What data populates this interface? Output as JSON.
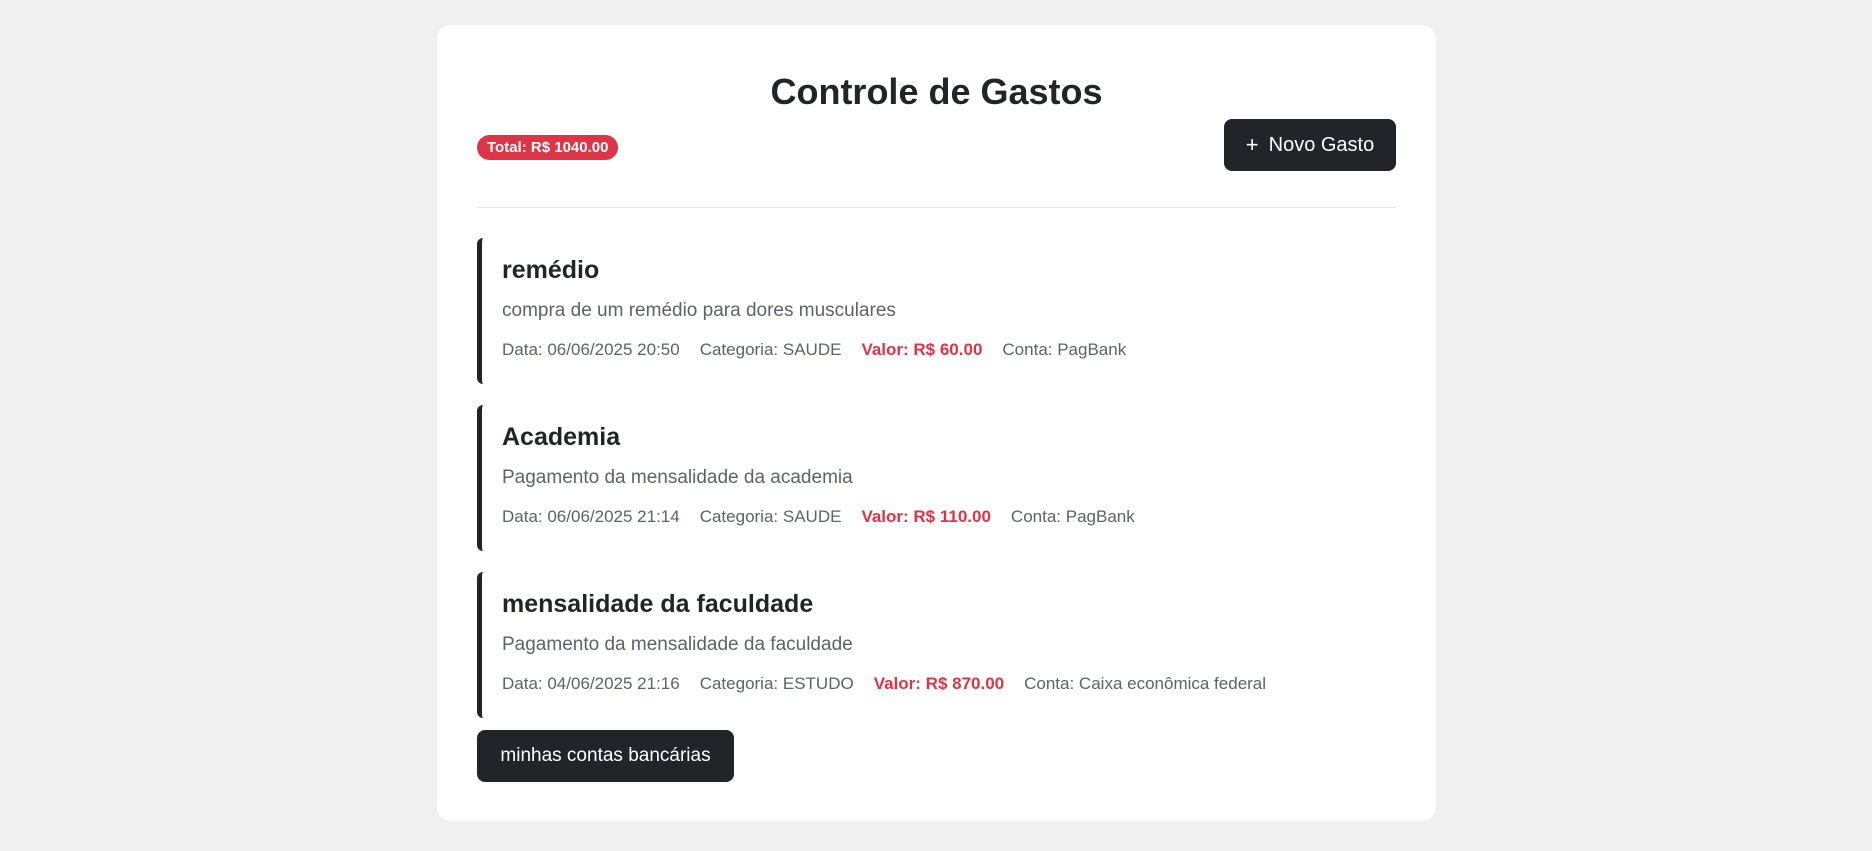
{
  "page": {
    "title": "Controle de Gastos"
  },
  "toolbar": {
    "total_label": "Total: R$ 1040.00",
    "new_button_icon": "+",
    "new_button_label": "Novo Gasto"
  },
  "expenses": [
    {
      "title": "remédio",
      "description": "compra de um remédio para dores musculares",
      "date": "Data: 06/06/2025 20:50",
      "category": "Categoria: SAUDE",
      "value": "Valor: R$ 60.00",
      "account": "Conta: PagBank"
    },
    {
      "title": "Academia",
      "description": "Pagamento da mensalidade da academia",
      "date": "Data: 06/06/2025 21:14",
      "category": "Categoria: SAUDE",
      "value": "Valor: R$ 110.00",
      "account": "Conta: PagBank"
    },
    {
      "title": "mensalidade da faculdade",
      "description": "Pagamento da mensalidade da faculdade",
      "date": "Data: 04/06/2025 21:16",
      "category": "Categoria: ESTUDO",
      "value": "Valor: R$ 870.00",
      "account": "Conta: Caixa econômica federal"
    }
  ],
  "footer": {
    "accounts_button_label": "minhas contas bancárias"
  },
  "colors": {
    "background": "#eff0ef",
    "card": "#ffffff",
    "primary_dark": "#212529",
    "danger": "#dc3545",
    "muted_text": "#5c636a"
  }
}
